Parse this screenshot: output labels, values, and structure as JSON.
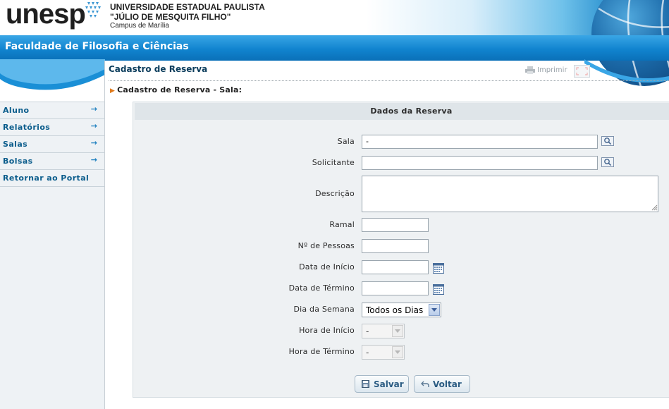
{
  "header": {
    "logo_text": "unesp",
    "institution_line1": "UNIVERSIDADE ESTADUAL PAULISTA",
    "institution_line2": "\"JÚLIO DE MESQUITA FILHO\"",
    "institution_line3": "Campus de Marília",
    "faculty": "Faculdade de Filosofia e Ciências"
  },
  "sidebar": {
    "items": [
      {
        "label": "Aluno",
        "has_arrow": true
      },
      {
        "label": "Relatórios",
        "has_arrow": true
      },
      {
        "label": "Salas",
        "has_arrow": true
      },
      {
        "label": "Bolsas",
        "has_arrow": true
      },
      {
        "label": "Retornar ao Portal",
        "has_arrow": false
      }
    ],
    "arrow": "→"
  },
  "page": {
    "title": "Cadastro de Reserva",
    "print_label": "Imprimir",
    "subtitle": "Cadastro de Reserva - Sala:"
  },
  "form": {
    "heading": "Dados da Reserva",
    "fields": {
      "sala": {
        "label": "Sala",
        "value": "-"
      },
      "solicitante": {
        "label": "Solicitante",
        "value": ""
      },
      "descricao": {
        "label": "Descrição",
        "value": ""
      },
      "ramal": {
        "label": "Ramal",
        "value": ""
      },
      "pessoas": {
        "label": "Nº de Pessoas",
        "value": ""
      },
      "data_inicio": {
        "label": "Data de Início",
        "value": ""
      },
      "data_termino": {
        "label": "Data de Término",
        "value": ""
      },
      "dia_semana": {
        "label": "Dia da Semana",
        "value": "Todos os Dias"
      },
      "hora_inicio": {
        "label": "Hora de Início",
        "value": "-"
      },
      "hora_termino": {
        "label": "Hora de Término",
        "value": "-"
      }
    },
    "buttons": {
      "save": "Salvar",
      "back": "Voltar"
    }
  },
  "colors": {
    "band": "#1184cf",
    "menu_text": "#0b5d8c",
    "title_text": "#0c3d5c",
    "button_text": "#2a5b82"
  }
}
